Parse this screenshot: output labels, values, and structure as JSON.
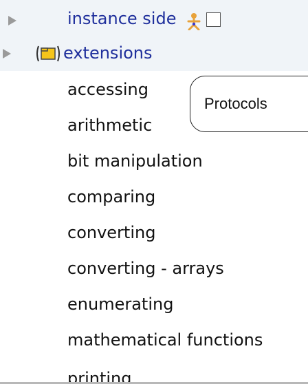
{
  "tree": {
    "instance_side": {
      "label": "instance side",
      "icon": "person-icon",
      "checkbox_checked": false
    },
    "extensions": {
      "label": "extensions",
      "icon": "package-icon"
    }
  },
  "protocols": [
    "accessing",
    "arithmetic",
    "bit manipulation",
    "comparing",
    "converting",
    "converting - arrays",
    "enumerating",
    "mathematical functions",
    "printing"
  ],
  "callout": {
    "text": "Protocols"
  },
  "colors": {
    "link_blue": "#1f2f9c",
    "band_background": "#f0f4f8",
    "person_icon_orange": "#e8a23a",
    "package_icon_yellow": "#f5c51a"
  }
}
